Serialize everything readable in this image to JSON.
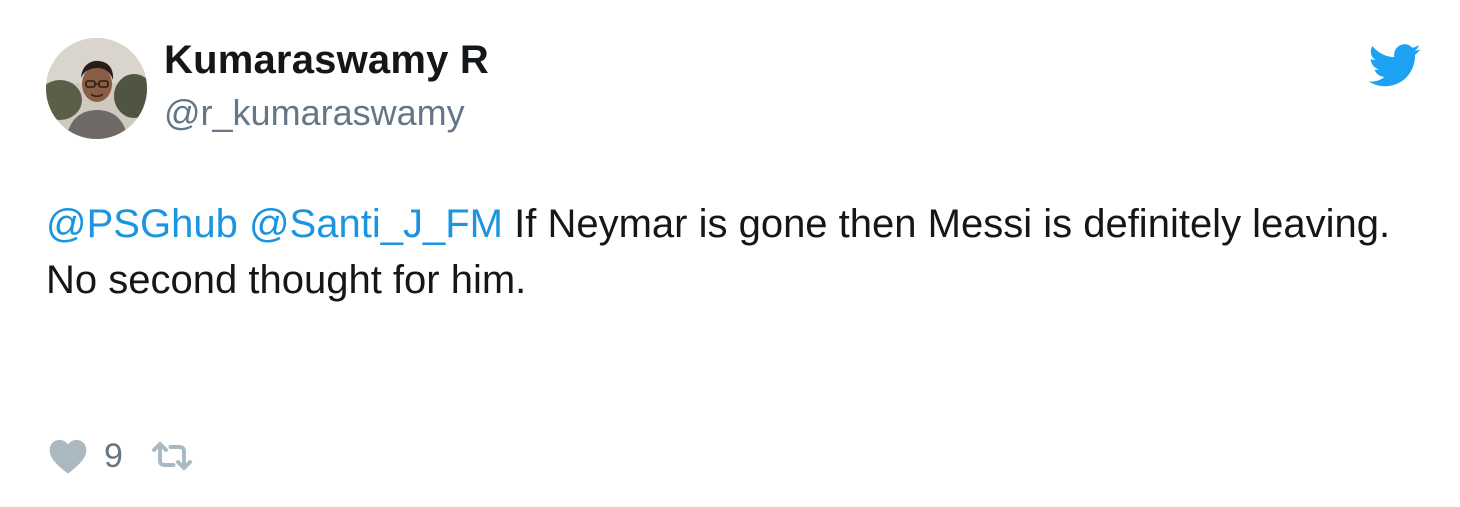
{
  "tweet": {
    "author": {
      "display_name": "Kumaraswamy R",
      "handle": "@r_kumaraswamy"
    },
    "mentions": [
      "@PSGhub",
      "@Santi_J_FM"
    ],
    "text": " If Neymar is gone then Messi is definitely leaving. No second thought for him.",
    "likes": "9"
  },
  "icons": {
    "brand": "twitter-bird-icon",
    "like": "heart-icon",
    "retweet": "retweet-icon"
  },
  "colors": {
    "twitter_blue": "#1da1f2",
    "mention": "#1b95e0",
    "secondary_text": "#657786",
    "primary_text": "#14171a",
    "icon_gray": "#aab8c2"
  }
}
